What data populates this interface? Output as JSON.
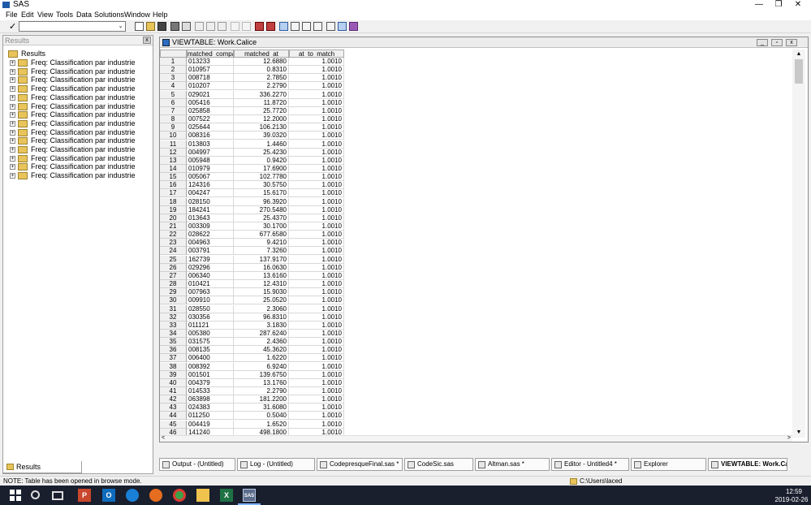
{
  "app": {
    "title": "SAS"
  },
  "window_controls": {
    "minimize": "—",
    "restore": "❐",
    "close": "✕"
  },
  "menu": [
    "File",
    "Edit",
    "View",
    "Tools",
    "Data",
    "Solutions",
    "Window",
    "Help"
  ],
  "toolbar": {
    "check_glyph": "✓",
    "command_value": "",
    "dropdown_glyph": "⌄"
  },
  "results_pane": {
    "header_label": "Results",
    "close_glyph": "x",
    "root_label": "Results",
    "expander_glyph": "+",
    "items": [
      "Freq:  Classification par industrie",
      "Freq:  Classification par industrie",
      "Freq:  Classification par industrie",
      "Freq:  Classification par industrie",
      "Freq:  Classification par industrie",
      "Freq:  Classification par industrie",
      "Freq:  Classification par industrie",
      "Freq:  Classification par industrie",
      "Freq:  Classification par industrie",
      "Freq:  Classification par industrie",
      "Freq:  Classification par industrie",
      "Freq:  Classification par industrie",
      "Freq:  Classification par industrie",
      "Freq:  Classification par industrie"
    ],
    "tab_label": "Results"
  },
  "viewtable": {
    "title": "VIEWTABLE: Work.Calice",
    "controls": {
      "minimize": "_",
      "restore": "▫",
      "close": "x"
    },
    "columns": [
      "matched_company",
      "matched_at",
      "at_to_match"
    ],
    "rows": [
      [
        "1",
        "013233",
        "12.6880",
        "1.0010"
      ],
      [
        "2",
        "010957",
        "0.8310",
        "1.0010"
      ],
      [
        "3",
        "008718",
        "2.7850",
        "1.0010"
      ],
      [
        "4",
        "010207",
        "2.2790",
        "1.0010"
      ],
      [
        "5",
        "029021",
        "336.2270",
        "1.0010"
      ],
      [
        "6",
        "005416",
        "11.8720",
        "1.0010"
      ],
      [
        "7",
        "025858",
        "25.7720",
        "1.0010"
      ],
      [
        "8",
        "007522",
        "12.2000",
        "1.0010"
      ],
      [
        "9",
        "025644",
        "106.2130",
        "1.0010"
      ],
      [
        "10",
        "008316",
        "39.0320",
        "1.0010"
      ],
      [
        "11",
        "013803",
        "1.4460",
        "1.0010"
      ],
      [
        "12",
        "004997",
        "25.4230",
        "1.0010"
      ],
      [
        "13",
        "005948",
        "0.9420",
        "1.0010"
      ],
      [
        "14",
        "010979",
        "17.6900",
        "1.0010"
      ],
      [
        "15",
        "005067",
        "102.7780",
        "1.0010"
      ],
      [
        "16",
        "124316",
        "30.5750",
        "1.0010"
      ],
      [
        "17",
        "004247",
        "15.6170",
        "1.0010"
      ],
      [
        "18",
        "028150",
        "96.3920",
        "1.0010"
      ],
      [
        "19",
        "184241",
        "270.5480",
        "1.0010"
      ],
      [
        "20",
        "013643",
        "25.4370",
        "1.0010"
      ],
      [
        "21",
        "003309",
        "30.1700",
        "1.0010"
      ],
      [
        "22",
        "028622",
        "677.6580",
        "1.0010"
      ],
      [
        "23",
        "004963",
        "9.4210",
        "1.0010"
      ],
      [
        "24",
        "003791",
        "7.3260",
        "1.0010"
      ],
      [
        "25",
        "162739",
        "137.9170",
        "1.0010"
      ],
      [
        "26",
        "029296",
        "16.0630",
        "1.0010"
      ],
      [
        "27",
        "006340",
        "13.6160",
        "1.0010"
      ],
      [
        "28",
        "010421",
        "12.4310",
        "1.0010"
      ],
      [
        "29",
        "007963",
        "15.9030",
        "1.0010"
      ],
      [
        "30",
        "009910",
        "25.0520",
        "1.0010"
      ],
      [
        "31",
        "028550",
        "2.3060",
        "1.0010"
      ],
      [
        "32",
        "030356",
        "96.8310",
        "1.0010"
      ],
      [
        "33",
        "011121",
        "3.1830",
        "1.0010"
      ],
      [
        "34",
        "005380",
        "287.6240",
        "1.0010"
      ],
      [
        "35",
        "031575",
        "2.4360",
        "1.0010"
      ],
      [
        "36",
        "008135",
        "45.3620",
        "1.0010"
      ],
      [
        "37",
        "006400",
        "1.6220",
        "1.0010"
      ],
      [
        "38",
        "008392",
        "6.9240",
        "1.0010"
      ],
      [
        "39",
        "001501",
        "139.6750",
        "1.0010"
      ],
      [
        "40",
        "004379",
        "13.1760",
        "1.0010"
      ],
      [
        "41",
        "014533",
        "2.2790",
        "1.0010"
      ],
      [
        "42",
        "063898",
        "181.2200",
        "1.0010"
      ],
      [
        "43",
        "024383",
        "31.6080",
        "1.0010"
      ],
      [
        "44",
        "011250",
        "0.5040",
        "1.0010"
      ],
      [
        "45",
        "004419",
        "1.6520",
        "1.0010"
      ],
      [
        "46",
        "141240",
        "498.1800",
        "1.0010"
      ]
    ],
    "scroll": {
      "up": "▲",
      "down": "▼",
      "left": "<",
      "right": ">"
    }
  },
  "task_tabs": [
    {
      "label": "Output - (Untitled)",
      "active": false
    },
    {
      "label": "Log - (Untitled)",
      "active": false
    },
    {
      "label": "CodepresqueFinal.sas *",
      "active": false
    },
    {
      "label": "CodeSic.sas",
      "active": false
    },
    {
      "label": "Altman.sas *",
      "active": false
    },
    {
      "label": "Editor - Untitled4 *",
      "active": false
    },
    {
      "label": "Explorer",
      "active": false
    },
    {
      "label": "VIEWTABLE: Work.Call...",
      "active": true
    }
  ],
  "status": {
    "message": "NOTE: Table has been opened in browse mode.",
    "path": "C:\\Users\\laced"
  },
  "taskbar": {
    "time": "12:59",
    "date": "2019-02-26",
    "app_letters": {
      "powerpoint": "P",
      "outlook": "O",
      "excel": "X",
      "sas": "SAS"
    }
  },
  "colors": {
    "taskbar_bg": "#1a1f2e",
    "sas_accent": "#1e5aa8",
    "folder": "#e8c45a"
  }
}
